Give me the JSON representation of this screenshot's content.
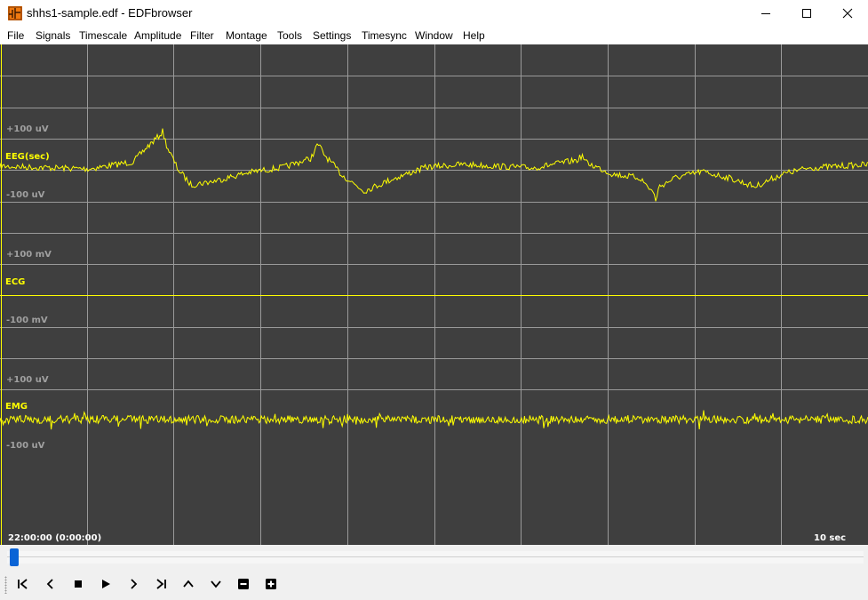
{
  "window": {
    "title": "shhs1-sample.edf - EDFbrowser",
    "controls": [
      "minimize",
      "maximize",
      "close"
    ]
  },
  "menu": [
    "File",
    "Signals",
    "Timescale",
    "Amplitude",
    "Filter",
    "Montage",
    "Tools",
    "Settings",
    "Timesync",
    "Window",
    "Help"
  ],
  "signals": [
    {
      "label": "EEG(sec)",
      "scale_top": "+100 uV",
      "scale_bottom": "-100 uV"
    },
    {
      "label": "ECG",
      "scale_top": "+100 mV",
      "scale_bottom": "-100 mV"
    },
    {
      "label": "EMG",
      "scale_top": "+100 uV",
      "scale_bottom": "-100 uV"
    }
  ],
  "timeline": {
    "start": "22:00:00 (0:00:00)",
    "duration": "10 sec",
    "position": 0.0
  },
  "toolbar": [
    "first-page",
    "previous",
    "stop",
    "play",
    "next",
    "last-page",
    "up",
    "down",
    "zoom-out",
    "zoom-in"
  ],
  "colors": {
    "background": "#3f3f3f",
    "grid": "#9a9a9a",
    "trace": "#ffff00",
    "scale_text": "#a0a0a0",
    "scroll_handle": "#0a64d6"
  }
}
